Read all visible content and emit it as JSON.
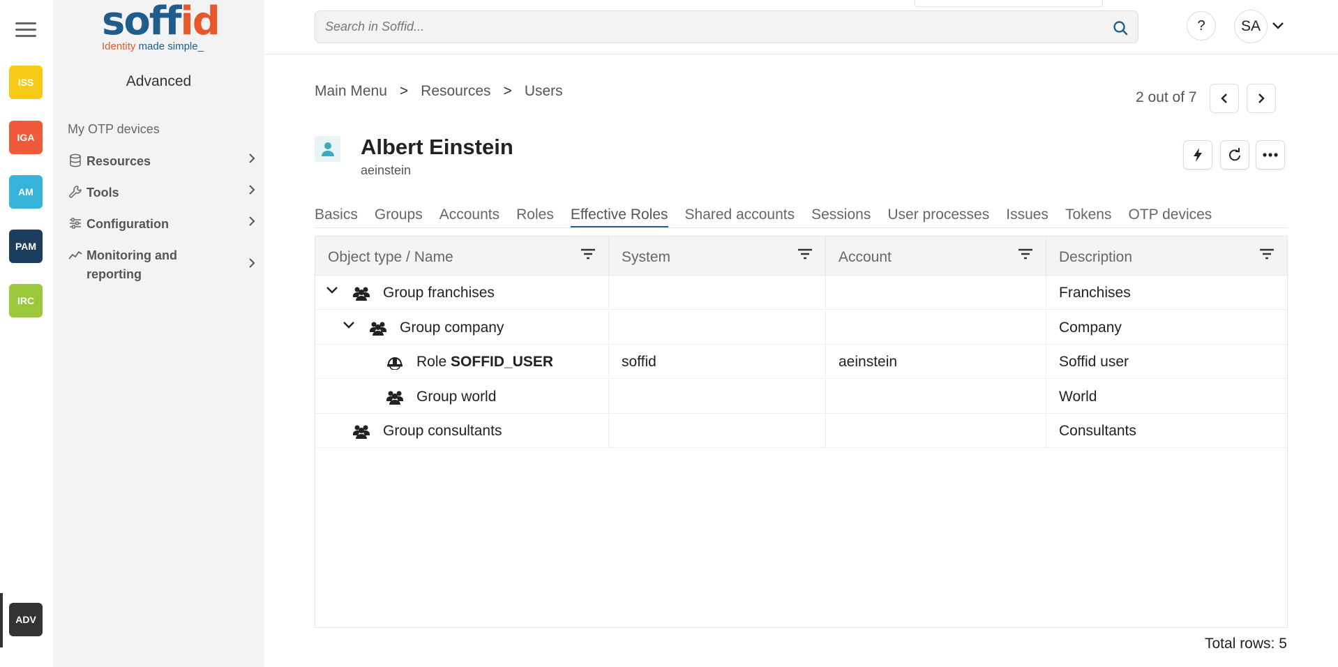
{
  "rail": {
    "modules": [
      {
        "label": "ISS",
        "color": "#f7cb15"
      },
      {
        "label": "IGA",
        "color": "#ef5a3a"
      },
      {
        "label": "AM",
        "color": "#36b3d9"
      },
      {
        "label": "PAM",
        "color": "#1b3e5e"
      },
      {
        "label": "IRC",
        "color": "#9cc83c"
      },
      {
        "label": "ADV",
        "color": "#333333"
      }
    ]
  },
  "sidebar": {
    "logo": {
      "word_a": "soff",
      "word_b": "id",
      "tag_a": "Identity",
      "tag_b": "made simple_"
    },
    "title": "Advanced",
    "plain_item": "My OTP devices",
    "items": [
      {
        "label": "Resources",
        "icon": "database-icon"
      },
      {
        "label": "Tools",
        "icon": "wrench-icon"
      },
      {
        "label": "Configuration",
        "icon": "sliders-icon"
      },
      {
        "label": "Monitoring and reporting",
        "icon": "chart-line-icon"
      }
    ]
  },
  "topbar": {
    "search_placeholder": "Search in Soffid...",
    "help": "?",
    "avatar": "SA"
  },
  "breadcrumb": {
    "items": [
      "Main Menu",
      "Resources",
      "Users"
    ],
    "sep": ">"
  },
  "pager": {
    "text": "2 out of 7"
  },
  "user": {
    "name": "Albert Einstein",
    "login": "aeinstein"
  },
  "tabs": [
    "Basics",
    "Groups",
    "Accounts",
    "Roles",
    "Effective Roles",
    "Shared accounts",
    "Sessions",
    "User processes",
    "Issues",
    "Tokens",
    "OTP devices"
  ],
  "active_tab": "Effective Roles",
  "table": {
    "columns": [
      "Object type / Name",
      "System",
      "Account",
      "Description"
    ],
    "rows": [
      {
        "prefix": "Group",
        "name": "franchises",
        "system": "",
        "account": "",
        "description": "Franchises"
      },
      {
        "prefix": "Group",
        "name": "company",
        "system": "",
        "account": "",
        "description": "Company"
      },
      {
        "prefix": "Role",
        "name": "SOFFID_USER",
        "system": "soffid",
        "account": "aeinstein",
        "description": "Soffid user"
      },
      {
        "prefix": "Group",
        "name": "world",
        "system": "",
        "account": "",
        "description": "World"
      },
      {
        "prefix": "Group",
        "name": "consultants",
        "system": "",
        "account": "",
        "description": "Consultants"
      }
    ],
    "total_label": "Total rows: 5"
  }
}
